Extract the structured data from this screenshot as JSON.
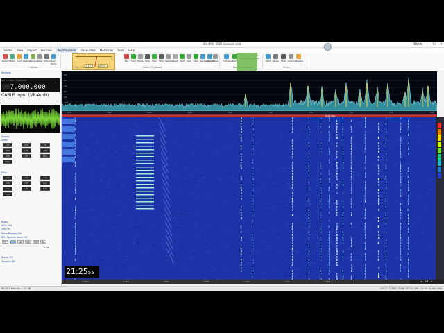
{
  "window": {
    "title": "IES 4AK - SDR Console v3.4",
    "controls": [
      "–",
      "☐",
      "✕"
    ],
    "user": "Style"
  },
  "menu": [
    "Home",
    "View",
    "Layout",
    "Receive",
    "Rec/Playback",
    "Favourites",
    "Memories",
    "Tools",
    "Help"
  ],
  "ribbon": {
    "buttons": [
      "Record",
      "Mute",
      "Conf",
      "Restore",
      "Receive",
      "Slow",
      "Options",
      "Lock Radio",
      "Home",
      "Browse",
      "Rec",
      "Start",
      "Pause",
      "Stop",
      "Play",
      "Stop",
      "Resume",
      "Next",
      "Start",
      "Scan",
      "Start",
      "Navigation",
      "Data/Rx",
      "Show",
      "Schedule",
      "Start"
    ],
    "groups": [
      "Audio",
      "Rec / Playback",
      "Data / Playback",
      "Data / Schedule",
      "Video"
    ],
    "meter_labels": [
      "S7 / 9",
      "S9+5"
    ],
    "schedule_opts": [
      "Show in status bar",
      "Start automatically"
    ],
    "video": [
      "Start",
      "Pause",
      "Stop",
      "Options",
      "Browse"
    ]
  },
  "left": {
    "header": "Receive",
    "freq_dim": "00",
    "freq_main": "7.000.000",
    "freq_labels": "RX 1     7.000 / 7.000 MHz",
    "source": "CABLE Input (VB-Audio",
    "sections": [
      "Display",
      "Mode",
      "Filter",
      "Radio",
      "AGC: Fast",
      "CW: Off",
      "Noise Blanker: Off",
      "NR / Spectral Noise: Off",
      "Bands: Off",
      "Squelch: Off"
    ],
    "mode_buttons": [
      "AM",
      "SAM",
      "FM",
      "WFM",
      "LSB",
      "USB",
      "DSB",
      "CW",
      "DIGL",
      "DIGU"
    ],
    "filter_buttons": [
      "6.0k",
      "5.0k",
      "4.0k",
      "3.0k",
      "2.7k",
      "2.4k",
      "2.1k",
      "1.8k",
      "1.5k",
      "1.0k"
    ],
    "band_buttons": [
      "HF",
      "MW",
      "LW",
      "SW",
      "160",
      "80"
    ],
    "volume": "11 dB"
  },
  "spectrum": {
    "level_labels": [
      "-50",
      "-60",
      "-70",
      "-80",
      "-90",
      "-100",
      "-110"
    ],
    "axis_ticks": [
      "6.75",
      "6.80",
      "6.85",
      "6.90",
      "6.95",
      "7.00",
      "7.05",
      "7.10",
      "7.15",
      "7.20"
    ],
    "filter_label": "High filter"
  },
  "waterfall": {
    "clock_hm": "21:25",
    "clock_s": "55",
    "bottom_ticks": [
      "6.900",
      "6.950",
      "7.000",
      "7.050",
      "7.100",
      "7.150",
      "7.200"
    ],
    "zoom": "x2"
  },
  "statusbar": {
    "left": "RX: 3.0 MHz  Rx = 10 dB",
    "right": "00:17  -1,368 / 0 MB  26.2%    CPU: 18.1%    Audio: 98%"
  },
  "colors": {
    "waterfall_bg": "#1d33a8",
    "audio_wave": "#7ddd3a",
    "filter_bar": "#b73331",
    "meter": "#f6d47a"
  }
}
